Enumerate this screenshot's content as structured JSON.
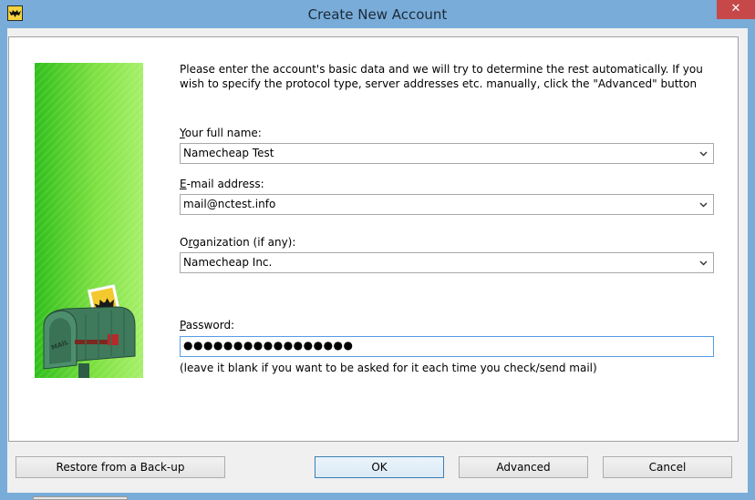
{
  "window": {
    "title": "Create New Account",
    "app_icon": "bat-mail-icon",
    "close_label": "✕"
  },
  "intro": "Please enter the account's basic data and we will try to determine the rest automatically. If you wish to specify the protocol type, server addresses etc. manually, click the \"Advanced\" button",
  "fields": {
    "full_name": {
      "label_access": "Y",
      "label_rest": "our full name:",
      "value": "Namecheap Test"
    },
    "email": {
      "label_access": "E",
      "label_rest": "-mail address:",
      "value": "mail@nctest.info"
    },
    "organization": {
      "label_pre": "O",
      "label_access": "r",
      "label_rest": "ganization (if any):",
      "value": "Namecheap Inc."
    },
    "password": {
      "label_access": "P",
      "label_rest": "assword:",
      "value": "●●●●●●●●●●●●●●●●●",
      "hint": "(leave it blank if you want to be asked for it each time you check/send mail)"
    }
  },
  "art": {
    "mailbox_text": "MAIL"
  },
  "buttons": {
    "restore": "Restore from a Back-up",
    "ok": "OK",
    "advanced": "Advanced",
    "cancel": "Cancel"
  },
  "colors": {
    "titlebar": "#79acd9",
    "close": "#c74848",
    "focus_border": "#569de5"
  }
}
